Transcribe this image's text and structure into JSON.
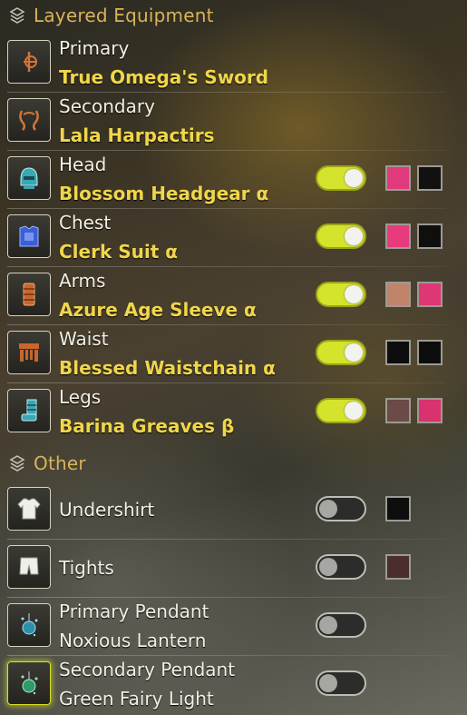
{
  "sections": {
    "layered": {
      "title": "Layered Equipment",
      "icon": "diamond-stack-icon"
    },
    "other": {
      "title": "Other",
      "icon": "diamond-stack-icon"
    }
  },
  "layered_items": [
    {
      "slot": "Primary",
      "name": "True Omega's Sword",
      "icon": "sword-icon"
    },
    {
      "slot": "Secondary",
      "name": "Lala Harpactirs",
      "icon": "claws-icon"
    },
    {
      "slot": "Head",
      "name": "Blossom Headgear α",
      "icon": "helmet-icon",
      "toggle": true,
      "colors": [
        "#e03a7c",
        "#111111"
      ]
    },
    {
      "slot": "Chest",
      "name": "Clerk Suit α",
      "icon": "chest-armor-icon",
      "toggle": true,
      "colors": [
        "#e83b7e",
        "#0f0f0f"
      ]
    },
    {
      "slot": "Arms",
      "name": "Azure Age Sleeve α",
      "icon": "gauntlet-icon",
      "toggle": true,
      "colors": [
        "#c0846a",
        "#de3776"
      ]
    },
    {
      "slot": "Waist",
      "name": "Blessed Waistchain α",
      "icon": "waist-armor-icon",
      "toggle": true,
      "colors": [
        "#0d0d0d",
        "#0d0d0d"
      ]
    },
    {
      "slot": "Legs",
      "name": "Barina Greaves β",
      "icon": "greaves-icon",
      "toggle": true,
      "colors": [
        "#6b4a48",
        "#d8336f"
      ]
    }
  ],
  "other_items": [
    {
      "slot": "Undershirt",
      "icon": "shirt-icon",
      "toggle": false,
      "colors": [
        "#0e0e0e"
      ]
    },
    {
      "slot": "Tights",
      "icon": "shorts-icon",
      "toggle": false,
      "colors": [
        "#4a2e2b"
      ]
    },
    {
      "slot": "Primary Pendant",
      "name": "Noxious Lantern",
      "icon": "pendant-icon",
      "toggle": false
    },
    {
      "slot": "Secondary Pendant",
      "name": "Green Fairy Light",
      "icon": "pendant-icon",
      "toggle": false,
      "active": true
    }
  ]
}
